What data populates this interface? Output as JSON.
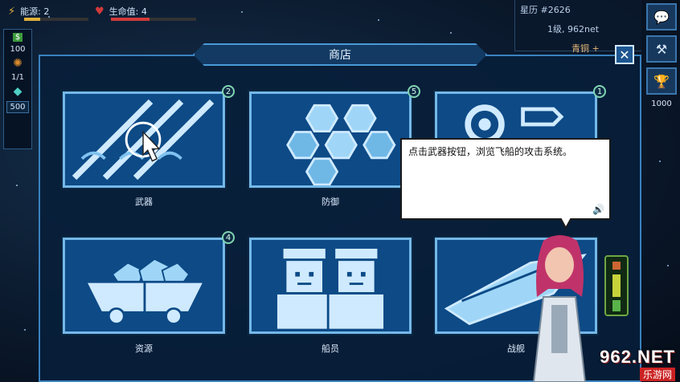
{
  "hud": {
    "energy_label": "能源: 2",
    "life_label": "生命值: 4",
    "energy_fraction": 0.25,
    "life_fraction": 0.45,
    "star_label": "星历 #2626",
    "ship_level": "1级, 962net",
    "rank_label": "青铜 +"
  },
  "left_col": {
    "money_icon": "cash-icon",
    "money_value": "100",
    "crew_value": "1/1",
    "crystal_value": "500"
  },
  "right_col": {
    "chat_icon": "chat-bubble-icon",
    "hammer_icon": "hammer-icon",
    "trophy_icon": "trophy-icon",
    "trophy_value": "1000"
  },
  "shop": {
    "title": "商店",
    "close_icon": "close-icon",
    "cards": [
      {
        "label": "武器",
        "badge": "2",
        "icon": "weapon-icon"
      },
      {
        "label": "防御",
        "badge": "5",
        "icon": "hexagon-shield-icon"
      },
      {
        "label": "",
        "badge": "1",
        "icon": "gear-icon"
      },
      {
        "label": "资源",
        "badge": "4",
        "icon": "ore-cart-icon"
      },
      {
        "label": "船员",
        "badge": "",
        "icon": "crew-icon"
      },
      {
        "label": "战舰",
        "badge": "",
        "icon": "ship-icon"
      }
    ]
  },
  "tooltip": {
    "text": "点击武器按钮，浏览飞船的攻击系统。",
    "speaker_icon": "speaker-icon"
  },
  "watermark": {
    "main": "962.NET",
    "sub": "乐游网"
  },
  "colors": {
    "panel_border": "#3a82bf",
    "card_bg": "#0d4a86",
    "badge_border": "#7fd3b0",
    "energy": "#e0b13a",
    "life": "#d23a3a"
  }
}
